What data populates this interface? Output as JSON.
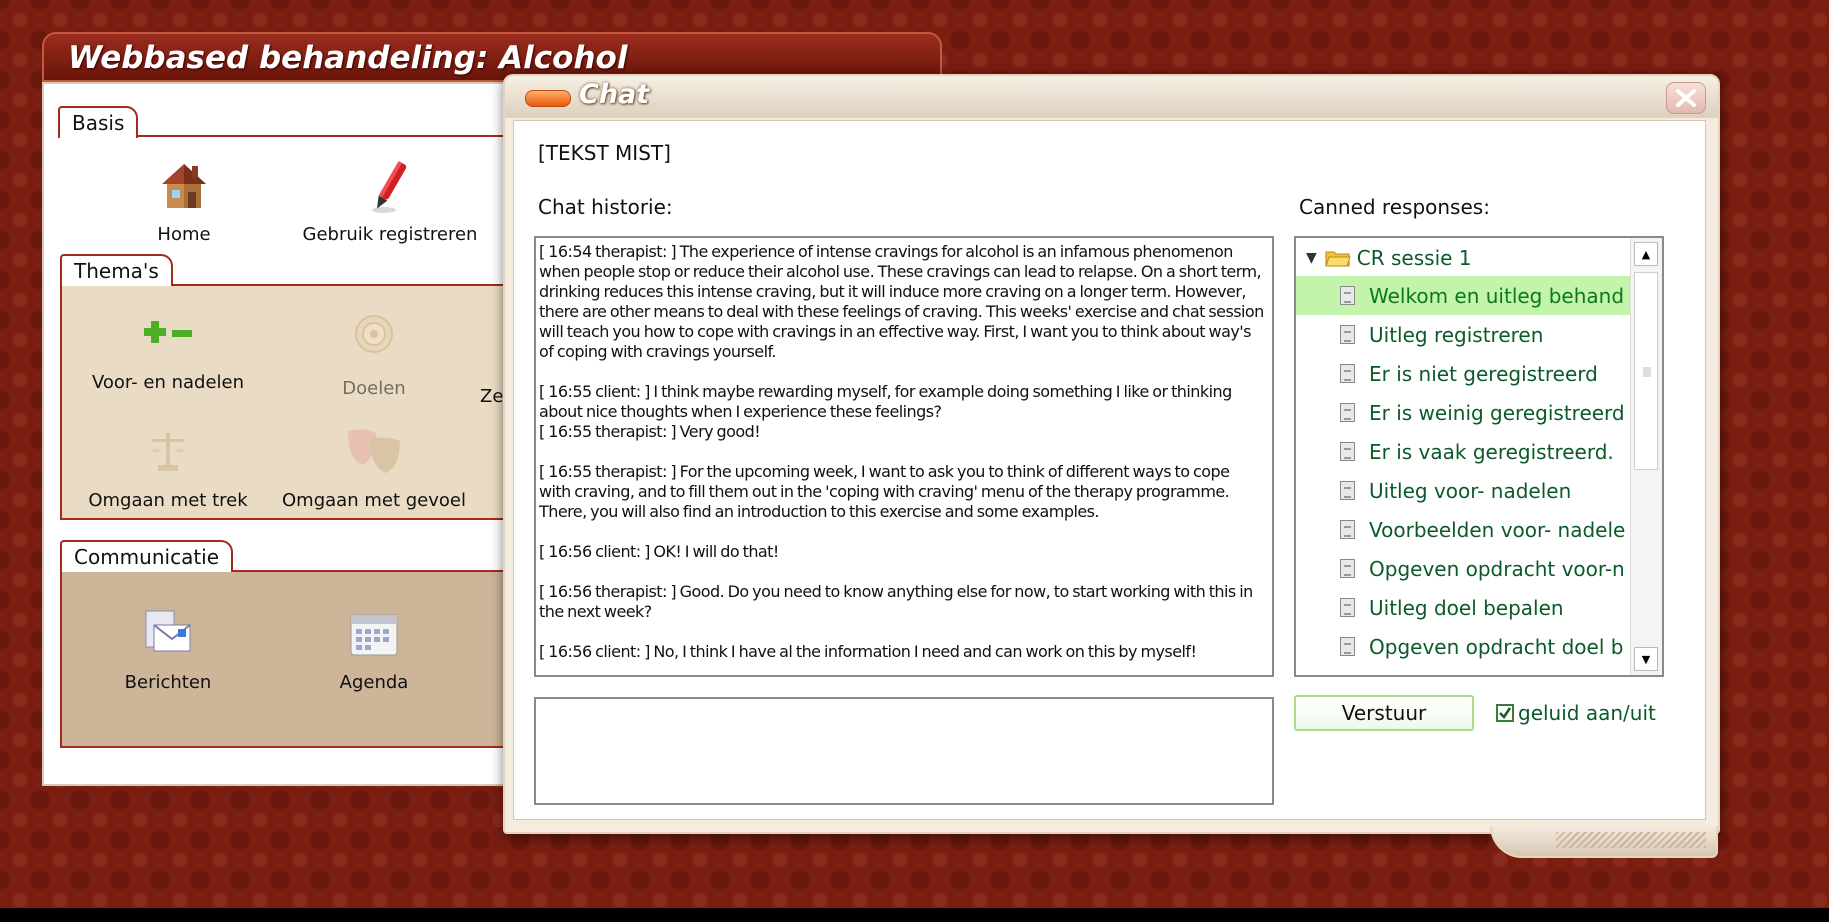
{
  "main_window": {
    "title": "Webbased behandeling: Alcohol",
    "sections": [
      {
        "tab": "Basis",
        "tiles": [
          "Home",
          "Gebruik registreren"
        ]
      },
      {
        "tab": "Thema's",
        "tiles": [
          "Voor- en nadelen",
          "Doelen",
          "Omgaan met trek",
          "Omgaan met gevoel"
        ],
        "clipped_label_fragment": "Ze"
      },
      {
        "tab": "Communicatie",
        "tiles": [
          "Berichten",
          "Agenda"
        ]
      }
    ]
  },
  "chat": {
    "title": "Chat",
    "missing_text": "[TEKST MIST]",
    "history_label": "Chat historie:",
    "canned_label": "Canned responses:",
    "messages": [
      "[ 16:54 therapist: ] The experience of intense cravings for alcohol is an infamous phenomenon when people stop or reduce their alcohol use. These cravings can lead to relapse. On a short term, drinking reduces this intense craving, but it will induce more craving on a longer term. However, there are other means to deal with these feelings of craving. This weeks' exercise and chat session will teach you how to cope with cravings in an effective way. First, I want you to think about way's of coping with cravings yourself.",
      "[ 16:55 client: ] I think maybe rewarding myself, for example doing something I like or thinking about nice thoughts when I experience these feelings?",
      "[ 16:55 therapist: ] Very good!",
      "[ 16:55 therapist: ] For the upcoming week, I want to ask you to think of different ways to cope with craving, and to fill them out in the 'coping with craving' menu of the therapy programme. There, you will also find an introduction to this exercise and some examples.",
      "[ 16:56 client: ] OK! I will do that!",
      "[ 16:56 therapist: ] Good. Do you need to know anything else for now, to start working with this in the next week?",
      "[ 16:56 client: ] No, I think I have al the information I need and can work on this by myself!"
    ],
    "canned": {
      "folder": "CR sessie 1",
      "items": [
        "Welkom en uitleg behand",
        "Uitleg registreren",
        "Er is niet geregistreerd",
        "Er is weinig geregistreerd",
        "Er is vaak geregistreerd.",
        "Uitleg voor- nadelen",
        "Voorbeelden voor- nadele",
        "Opgeven opdracht voor-n",
        "Uitleg doel bepalen",
        "Opgeven opdracht doel b"
      ],
      "selected_index": 0
    },
    "input_value": "",
    "send_label": "Verstuur",
    "sound_label": "geluid aan/uit",
    "sound_checked": true
  }
}
